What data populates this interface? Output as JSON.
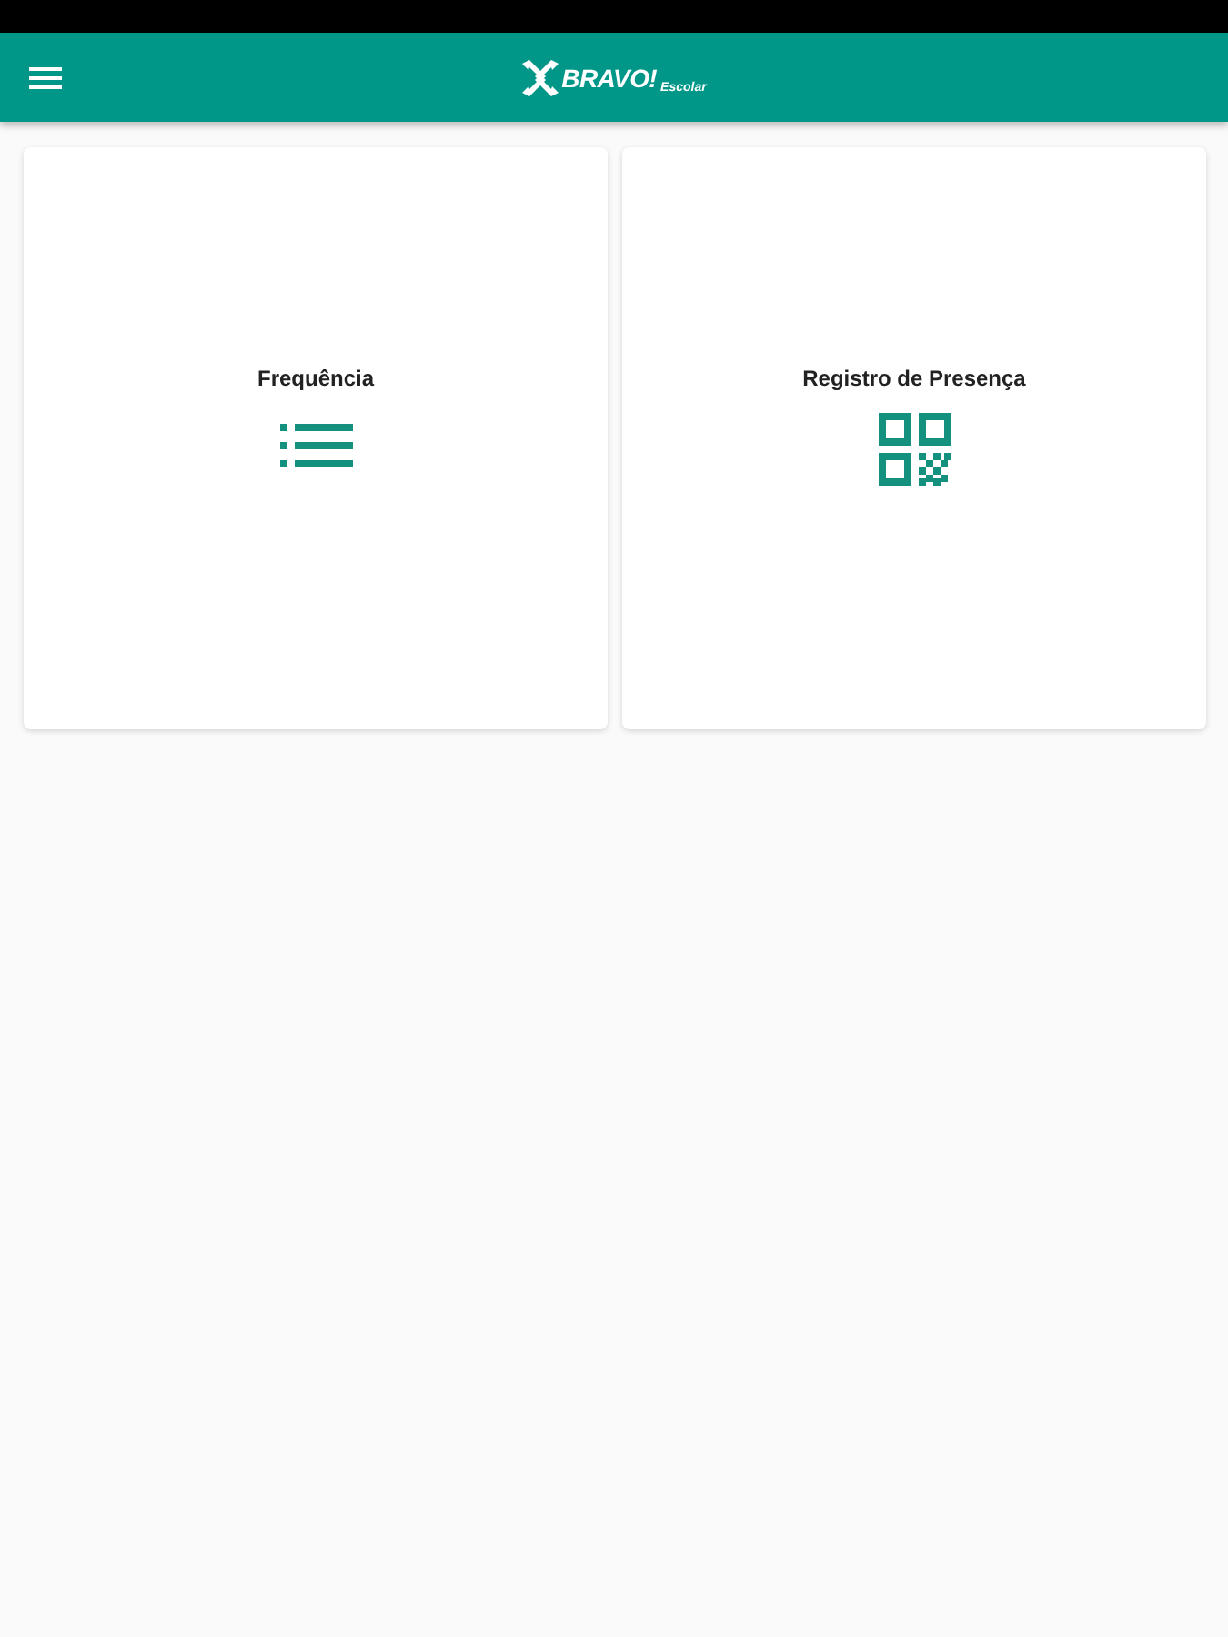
{
  "app_bar": {
    "logo": {
      "name": "BRAVO!",
      "tagline": "Escolar"
    }
  },
  "cards": [
    {
      "kind": "list",
      "title": "Frequência"
    },
    {
      "kind": "qr",
      "title": "Registro de Presença"
    }
  ]
}
